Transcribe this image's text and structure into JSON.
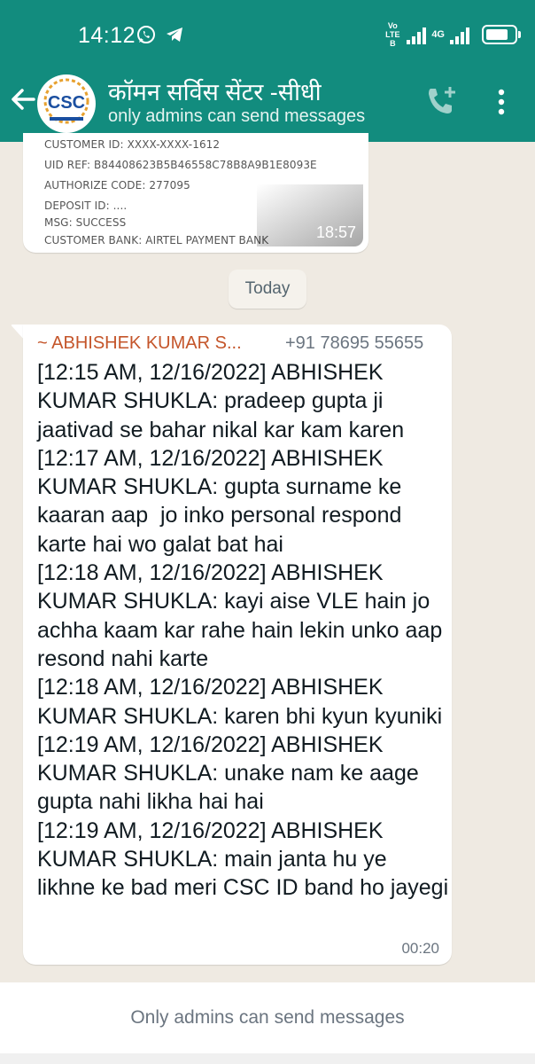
{
  "status_bar": {
    "time": "14:12",
    "carrier_badge_top": "Vo",
    "carrier_badge_bottom": "LTE B",
    "network_type": "4G"
  },
  "app_bar": {
    "title": "कॉमन सर्विस सेंटर -सीधी",
    "subtitle": "only admins can send messages",
    "avatar_text": "CSC"
  },
  "previous_message": {
    "receipt_lines": [
      "CUSTOMER ID: XXXX-XXXX-1612",
      "UID REF: B84408623B5B46558C78B8A9B1E8093E",
      "AUTHORIZE CODE: 277095",
      "DEPOSIT ID: ....",
      "MSG: SUCCESS",
      "CUSTOMER BANK: AIRTEL PAYMENT BANK"
    ],
    "time": "18:57"
  },
  "date_chip": "Today",
  "message": {
    "sender_name": "~ ABHISHEK KUMAR S...",
    "sender_phone": "+91 78695 55655",
    "text": "[12:15 AM, 12/16/2022] ABHISHEK KUMAR SHUKLA: pradeep gupta ji jaativad se bahar nikal kar kam karen\n[12:17 AM, 12/16/2022] ABHISHEK KUMAR SHUKLA: gupta surname ke kaaran aap  jo inko personal respond karte hai wo galat bat hai\n[12:18 AM, 12/16/2022] ABHISHEK KUMAR SHUKLA: kayi aise VLE hain jo achha kaam kar rahe hain lekin unko aap resond nahi karte\n[12:18 AM, 12/16/2022] ABHISHEK KUMAR SHUKLA: karen bhi kyun kyuniki\n[12:19 AM, 12/16/2022] ABHISHEK KUMAR SHUKLA: unake nam ke aage gupta nahi likha hai hai\n[12:19 AM, 12/16/2022] ABHISHEK KUMAR SHUKLA: main janta hu ye likhne ke bad meri CSC ID band ho jayegi",
    "time": "00:20"
  },
  "footer": {
    "notice": "Only admins can send messages"
  },
  "colors": {
    "header": "#128c7e",
    "chat_background": "#efeae2",
    "sender_name": "#c4552a"
  },
  "icons": [
    "whatsapp-icon",
    "telegram-icon",
    "back-arrow-icon",
    "add-call-icon",
    "more-options-icon"
  ],
  "battery_level": 0.8
}
